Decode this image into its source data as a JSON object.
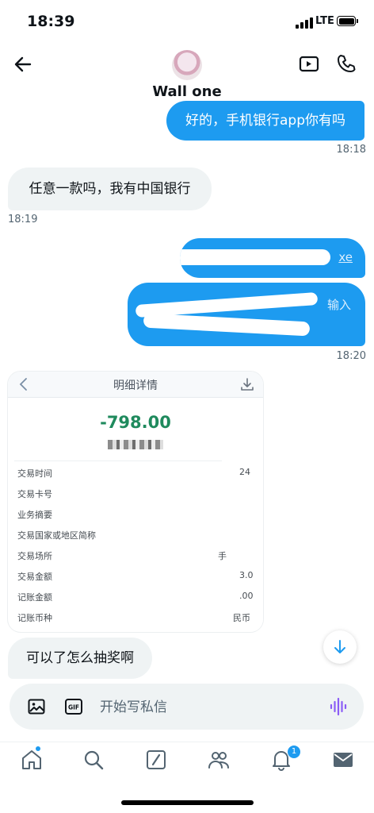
{
  "status_bar": {
    "time": "18:39",
    "network": "LTE"
  },
  "header": {
    "name": "Wall one"
  },
  "messages": [
    {
      "text": "好的，手机银行app你有吗",
      "time": "18:18"
    },
    {
      "text": "任意一款吗，我有中国银行",
      "time": "18:19"
    },
    {
      "text": "xe",
      "time": ""
    },
    {
      "text": "输入",
      "time": "18:20"
    },
    {
      "text": "可以了怎么抽奖啊",
      "time": ""
    }
  ],
  "receipt": {
    "title": "明细详情",
    "amount": "-798.00",
    "rows": [
      {
        "label": "交易时间",
        "value": "24"
      },
      {
        "label": "交易卡号",
        "value": ""
      },
      {
        "label": "业务摘要",
        "value": ""
      },
      {
        "label": "交易国家或地区简称",
        "value": ""
      },
      {
        "label": "交易场所",
        "value": "手"
      },
      {
        "label": "交易金额",
        "value": "3.0"
      },
      {
        "label": "记账金额",
        "value": ".00"
      },
      {
        "label": "记账币种",
        "value": "民币"
      }
    ]
  },
  "composer": {
    "placeholder": "开始写私信",
    "gif_label": "GIF"
  },
  "tabbar": {
    "items": [
      "home",
      "search",
      "grok",
      "communities",
      "notifications",
      "messages"
    ],
    "notification_count": "1"
  },
  "colors": {
    "accent": "#1d9bf0",
    "amount": "#1f8a5d"
  }
}
